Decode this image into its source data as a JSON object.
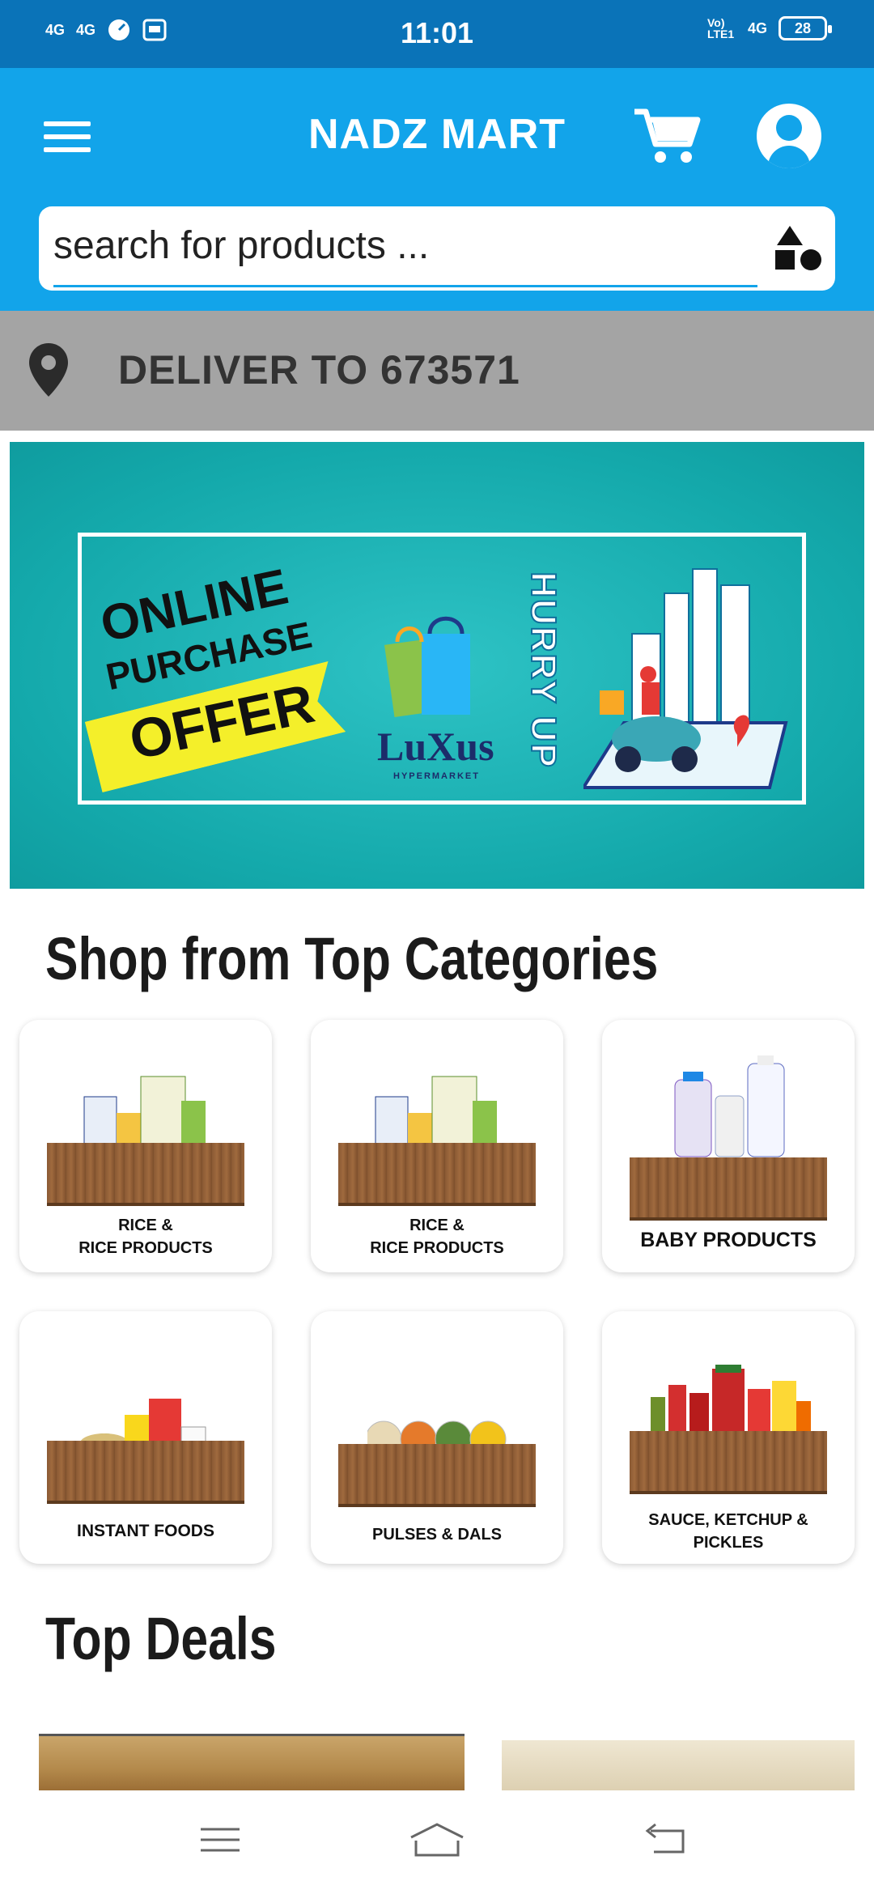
{
  "status_bar": {
    "time": "11:01",
    "signal_1": "4G",
    "signal_2": "4G",
    "volte": "Vo) LTE1",
    "network_right": "4G",
    "battery": "28"
  },
  "app_bar": {
    "title": "NADZ MART",
    "menu_icon": "hamburger-menu-icon",
    "cart_icon": "cart-icon",
    "account_icon": "account-icon"
  },
  "search": {
    "placeholder": "search for products ...",
    "value": "",
    "category_icon": "shapes-icon"
  },
  "delivery": {
    "icon": "location-pin-icon",
    "text": "DELIVER TO 673571"
  },
  "banner": {
    "line1": "ONLINE",
    "line2": "PURCHASE",
    "line3": "OFFER",
    "brand": "LuXus",
    "brand_sub": "HYPERMARKET",
    "callout": "HURRY UP"
  },
  "categories": {
    "title": "Shop from Top Categories",
    "items": [
      {
        "label_line1": "RICE &",
        "label_line2": "RICE PRODUCTS"
      },
      {
        "label_line1": "RICE &",
        "label_line2": "RICE PRODUCTS"
      },
      {
        "label_line1": "BABY PRODUCTS",
        "label_line2": ""
      },
      {
        "label_line1": "INSTANT FOODS",
        "label_line2": ""
      },
      {
        "label_line1": "PULSES & DALS",
        "label_line2": ""
      },
      {
        "label_line1": "SAUCE, KETCHUP &",
        "label_line2": "PICKLES"
      }
    ]
  },
  "deals": {
    "title": "Top Deals"
  },
  "nav_bar": {
    "menu_icon": "recent-apps-icon",
    "home_icon": "home-icon",
    "back_icon": "back-icon"
  },
  "colors": {
    "status_bar": "#0a73b8",
    "app_bar": "#12a4ea",
    "delivery_bar": "#a4a4a4",
    "banner_teal": "#14a9ab"
  }
}
